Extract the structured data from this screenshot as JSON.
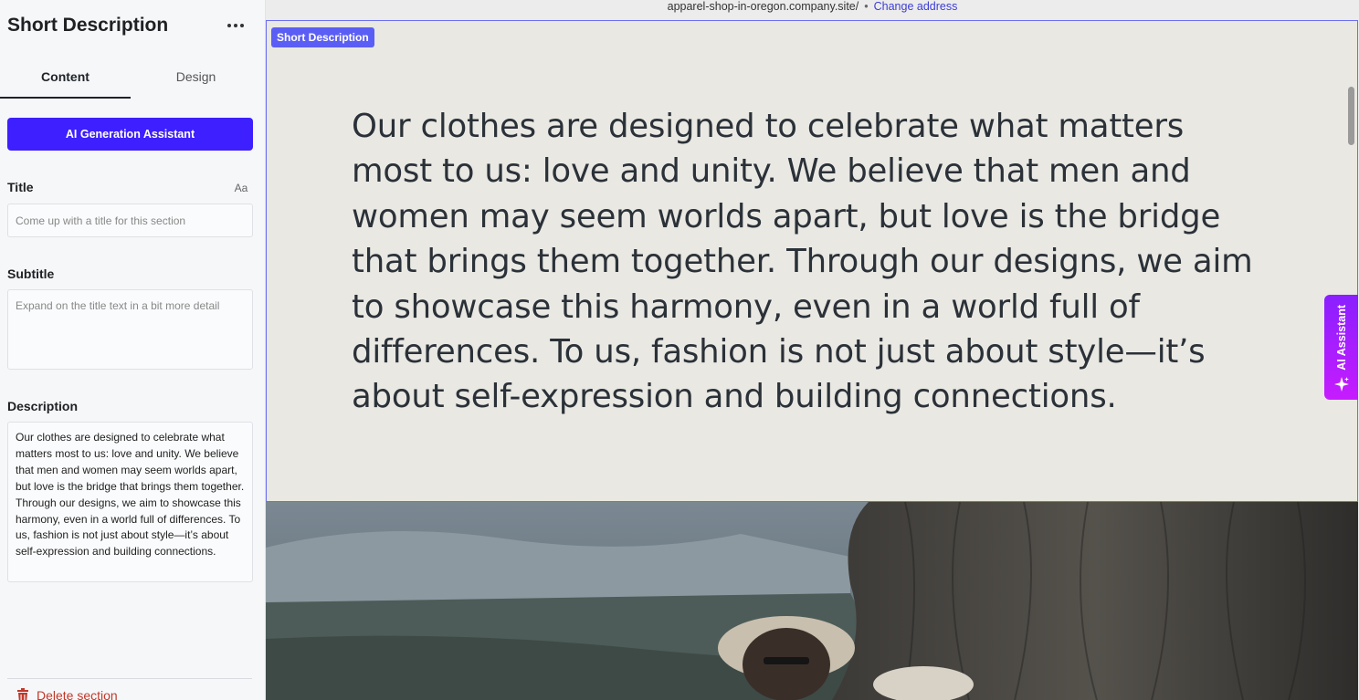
{
  "sidebar": {
    "title": "Short Description",
    "tabs": [
      {
        "label": "Content"
      },
      {
        "label": "Design"
      }
    ],
    "ai_generation_button": "AI Generation Assistant",
    "title_field": {
      "label": "Title",
      "placeholder": "Come up with a title for this section",
      "format_button": "Aa"
    },
    "subtitle_field": {
      "label": "Subtitle",
      "placeholder": "Expand on the title text in a bit more detail"
    },
    "description_field": {
      "label": "Description",
      "value": "Our clothes are designed to celebrate what matters most to us: love and unity. We believe that men and women may seem worlds apart, but love is the bridge that brings them together. Through our designs, we aim to showcase this harmony, even in a world full of differences. To us, fashion is not just about style—it’s about self-expression and building connections."
    },
    "delete_button": "Delete section"
  },
  "main": {
    "address": "apparel-shop-in-oregon.company.site/",
    "separator": "•",
    "change_address": "Change address",
    "section_tag": "Short Description",
    "section_text": "Our clothes are designed to celebrate what matters most to us: love and unity. We believe that men and women may seem worlds apart, but love is the bridge that brings them together. Through our designs, we aim to showcase this harmony, even in a world full of differences. To us, fashion is not just about style—it’s about self-expression and building connections.",
    "ai_assistant_label": "AI Assistant"
  },
  "colors": {
    "primary_button": "#3d1fff",
    "section_highlight": "#5b5ef4",
    "ai_assistant_gradient_start": "#8a1fff",
    "ai_assistant_gradient_end": "#c61cff",
    "delete": "#c0392b",
    "link": "#3d3dd6"
  },
  "icons": [
    "more-horizontal-icon",
    "trash-icon",
    "sparkle-icon"
  ]
}
